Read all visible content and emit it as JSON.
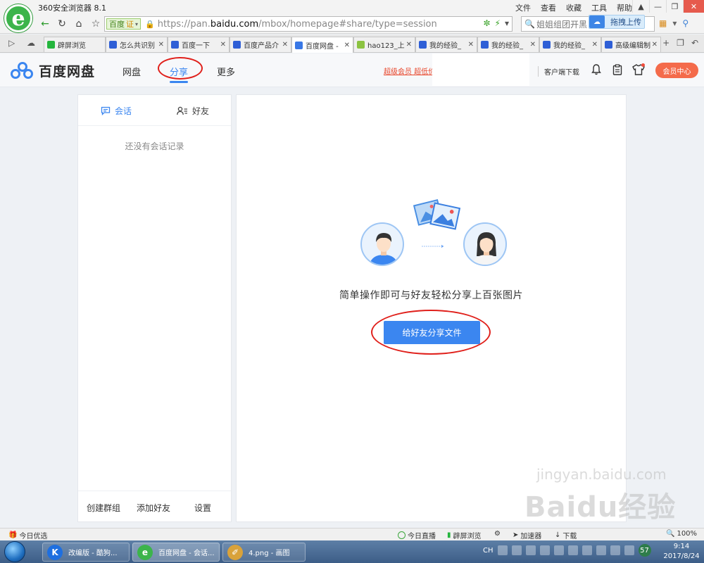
{
  "browser": {
    "title": "360安全浏览器 8.1",
    "menu": [
      "文件",
      "查看",
      "收藏",
      "工具",
      "帮助"
    ],
    "url_badge": "百度",
    "url_badge_cert": "证",
    "url_prefix": "https://pan.",
    "url_domain": "baidu.com",
    "url_path": "/mbox/homepage#share/type=session",
    "search_text": "姐姐组团开黑",
    "upload_chip": "拖拽上传",
    "tabs": [
      {
        "label": "辟屏浏览",
        "icon": "phone"
      },
      {
        "label": "怎么共识别",
        "icon": "paw"
      },
      {
        "label": "百度一下",
        "icon": "paw"
      },
      {
        "label": "百度产品介",
        "icon": "paw"
      },
      {
        "label": "百度网盘 -",
        "icon": "baidu"
      },
      {
        "label": "hao123_上",
        "icon": "hao"
      },
      {
        "label": "我的经验_",
        "icon": "paw"
      },
      {
        "label": "我的经验_",
        "icon": "paw"
      },
      {
        "label": "我的经验_",
        "icon": "paw"
      },
      {
        "label": "高级编辑制",
        "icon": "paw"
      }
    ]
  },
  "header": {
    "logo_text": "百度网盘",
    "nav": [
      "网盘",
      "分享",
      "更多"
    ],
    "vip_link": "超级会员 超低价",
    "client_download": "客户端下载",
    "vip_center": "会员中心"
  },
  "left_panel": {
    "tab_session": "会话",
    "tab_friends": "好友",
    "empty_text": "还没有会话记录",
    "footer": [
      "创建群组",
      "添加好友",
      "设置"
    ]
  },
  "main": {
    "share_text": "简单操作即可与好友轻松分享上百张图片",
    "share_button": "给好友分享文件"
  },
  "statusbar": {
    "left": "今日优选",
    "items": [
      "今日直播",
      "辟屏浏览",
      "加速器",
      "下载",
      "100%"
    ]
  },
  "taskbar": {
    "tasks": [
      "改编版 - 酷狗...",
      "百度网盘 - 会话...",
      "4.png - 画图"
    ],
    "lang": "CH",
    "tray_badge": "57",
    "time": "9:14",
    "date": "2017/8/24"
  },
  "watermark": {
    "main": "Baidu经验",
    "sub": "jingyan.baidu.com"
  },
  "colors": {
    "accent": "#3b86f0",
    "annotation": "#e0201b",
    "vip": "#f46b4b"
  }
}
